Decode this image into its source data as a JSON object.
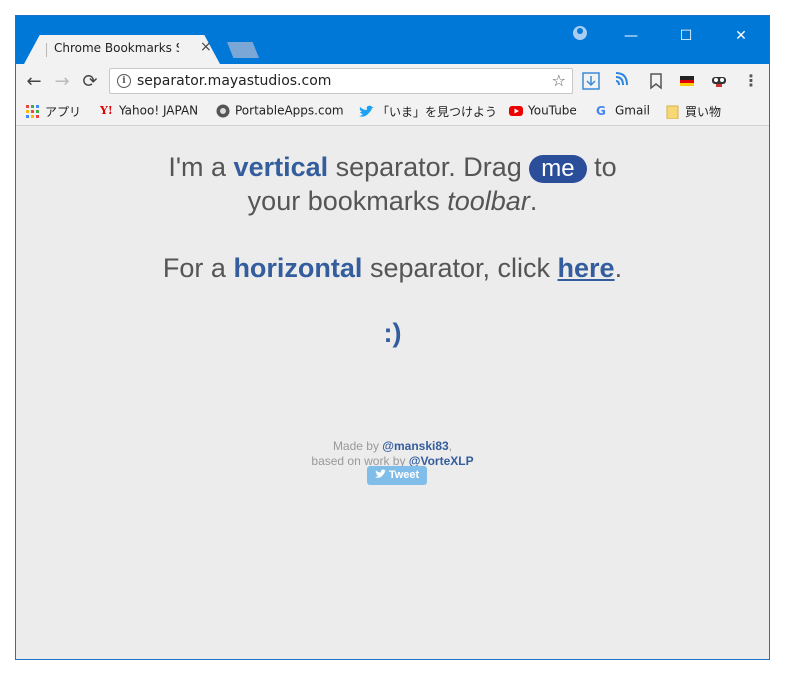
{
  "tab": {
    "title": "Chrome Bookmarks Se",
    "close": "×"
  },
  "window_controls": {
    "minimize": "—",
    "maximize": "☐",
    "close": "✕"
  },
  "nav": {
    "back": "←",
    "forward": "→",
    "reload": "⟳"
  },
  "omnibox": {
    "url": "separator.mayastudios.com",
    "info_glyph": "i",
    "star_glyph": "☆"
  },
  "extensions": [
    "download-icon",
    "cast-icon",
    "bookmark-icon",
    "flag-icon",
    "mask-icon",
    "menu-icon"
  ],
  "bookmarks": [
    {
      "label": "アプリ",
      "icon": "apps-grid-icon"
    },
    {
      "label": "Yahoo! JAPAN",
      "icon": "yahoo-icon"
    },
    {
      "label": "PortableApps.com",
      "icon": "portableapps-icon"
    },
    {
      "label": "「いま」を見つけよう",
      "icon": "twitter-icon"
    },
    {
      "label": "YouTube",
      "icon": "youtube-icon"
    },
    {
      "label": "Gmail",
      "icon": "google-icon"
    },
    {
      "label": "買い物",
      "icon": "folder-icon"
    }
  ],
  "content": {
    "l1_a": "I'm a ",
    "l1_b": "vertical",
    "l1_c": " separator. Drag ",
    "l1_pill": "me",
    "l1_d": " to",
    "l2_a": "your bookmarks ",
    "l2_b": "toolbar",
    "l2_c": ".",
    "l3_a": "For a ",
    "l3_b": "horizontal",
    "l3_c": " separator, click ",
    "l3_link": "here",
    "l3_d": ".",
    "smiley": ":)",
    "credit1_a": "Made by ",
    "credit1_link": "@manski83",
    "credit1_b": ",",
    "credit2_a": "based on work by ",
    "credit2_link": "@VorteXLP",
    "tweet": "Tweet"
  },
  "colors": {
    "titlebar": "#0078d7",
    "accent": "#345d9d",
    "pill": "#2b4e9a",
    "tweet": "#80bde8"
  }
}
